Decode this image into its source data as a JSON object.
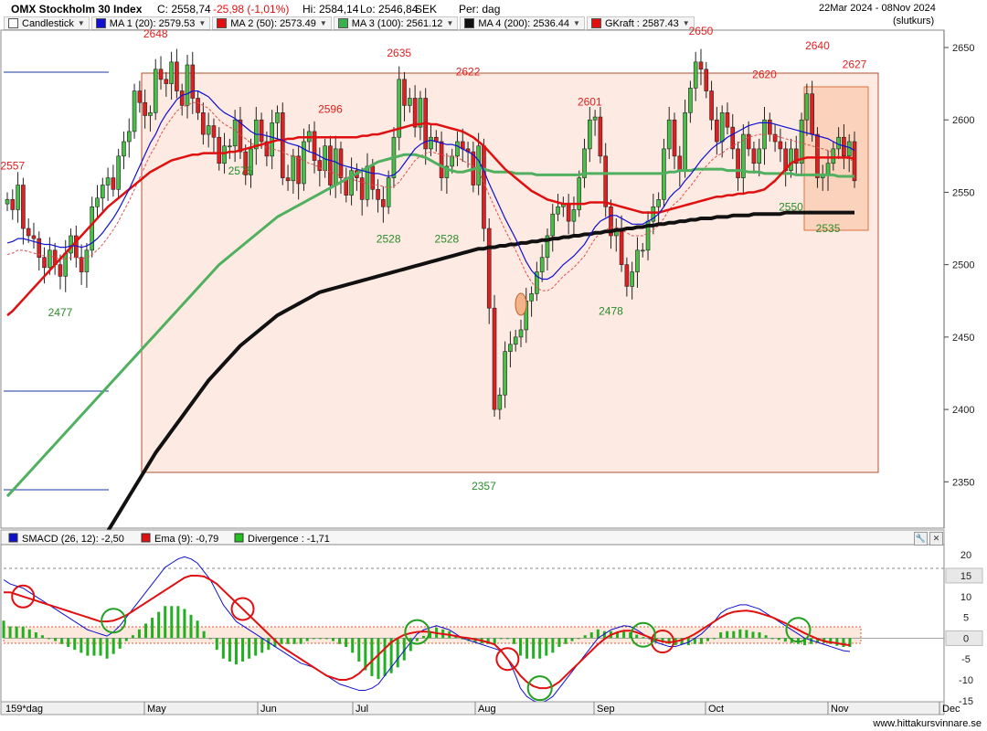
{
  "header": {
    "title": "OMX Stockholm 30 Index",
    "close": "C: 2558,74",
    "change": "-25,98 (-1,01%)",
    "high": "Hi: 2584,14",
    "low": "Lo: 2546,84",
    "currency": "SEK",
    "period": "Per: dag",
    "date_range": "22Mar 2024 - 08Nov 2024",
    "price_type": "(slutkurs)"
  },
  "legend": [
    {
      "label": "Candlestick",
      "color": "#ffffff"
    },
    {
      "label": "MA 1 (20): 2579.53",
      "color": "#1010d0"
    },
    {
      "label": "MA 2 (50): 2573.49",
      "color": "#e01010"
    },
    {
      "label": "MA 3 (100): 2561.12",
      "color": "#3cb04c"
    },
    {
      "label": "MA 4 (200): 2536.44",
      "color": "#111111"
    },
    {
      "label": "GKraft : 2587.43",
      "color": "#e01010"
    }
  ],
  "sub_legend": [
    {
      "label": "SMACD (26, 12): -2,50",
      "color": "#1010d0"
    },
    {
      "label": "Ema (9): -0,79",
      "color": "#e01010"
    },
    {
      "label": "Divergence : -1,71",
      "color": "#22c022"
    }
  ],
  "footer": {
    "period_label": "159*dag",
    "site": "www.hittakursvinnare.se"
  },
  "chart_data": [
    {
      "type": "line",
      "title": "OMX Stockholm 30 Index",
      "y_axis_ticks": [
        2350,
        2400,
        2450,
        2500,
        2550,
        2600,
        2650
      ],
      "ylim": [
        2318,
        2662
      ],
      "x_month_labels": [
        "May",
        "Jun",
        "Jul",
        "Aug",
        "Sep",
        "Oct",
        "Nov",
        "Dec"
      ],
      "annotations_high": [
        {
          "value": "2557",
          "i": 1
        },
        {
          "value": "2648",
          "i": 28
        },
        {
          "value": "2635",
          "i": 74
        },
        {
          "value": "2622",
          "i": 87
        },
        {
          "value": "2596",
          "i": 61
        },
        {
          "value": "2601",
          "i": 110
        },
        {
          "value": "2650",
          "i": 131
        },
        {
          "value": "2620",
          "i": 143
        },
        {
          "value": "2640",
          "i": 153
        },
        {
          "value": "2627",
          "i": 160
        }
      ],
      "annotations_low": [
        {
          "value": "2477",
          "i": 10
        },
        {
          "value": "2575",
          "i": 44
        },
        {
          "value": "2528",
          "i": 72
        },
        {
          "value": "2528",
          "i": 83
        },
        {
          "value": "2357",
          "i": 90
        },
        {
          "value": "2478",
          "i": 114
        },
        {
          "value": "2550",
          "i": 148
        },
        {
          "value": "2535",
          "i": 155
        }
      ],
      "close_series": [
        2545,
        2538,
        2555,
        2525,
        2520,
        2518,
        2505,
        2498,
        2510,
        2500,
        2492,
        2508,
        2520,
        2505,
        2495,
        2510,
        2540,
        2546,
        2555,
        2560,
        2552,
        2575,
        2585,
        2592,
        2620,
        2612,
        2603,
        2605,
        2635,
        2628,
        2625,
        2640,
        2620,
        2610,
        2638,
        2615,
        2605,
        2590,
        2596,
        2588,
        2570,
        2582,
        2582,
        2600,
        2578,
        2562,
        2580,
        2600,
        2585,
        2575,
        2598,
        2605,
        2560,
        2558,
        2575,
        2556,
        2585,
        2592,
        2572,
        2565,
        2582,
        2555,
        2580,
        2560,
        2548,
        2565,
        2560,
        2545,
        2568,
        2552,
        2545,
        2540,
        2560,
        2588,
        2628,
        2610,
        2615,
        2595,
        2615,
        2580,
        2588,
        2585,
        2560,
        2568,
        2575,
        2585,
        2580,
        2578,
        2555,
        2582,
        2525,
        2470,
        2400,
        2410,
        2440,
        2445,
        2450,
        2455,
        2475,
        2480,
        2495,
        2505,
        2520,
        2535,
        2540,
        2542,
        2530,
        2538,
        2560,
        2580,
        2600,
        2602,
        2575,
        2540,
        2520,
        2525,
        2500,
        2485,
        2495,
        2510,
        2510,
        2530,
        2540,
        2545,
        2580,
        2600,
        2575,
        2565,
        2605,
        2622,
        2640,
        2635,
        2620,
        2600,
        2585,
        2605,
        2595,
        2580,
        2560,
        2590,
        2580,
        2570,
        2580,
        2600,
        2590,
        2585,
        2580,
        2565,
        2580,
        2570,
        2600,
        2618,
        2590,
        2560,
        2562,
        2570,
        2580,
        2588,
        2575,
        2585,
        2558
      ],
      "ma20": [
        2515,
        2516,
        2518,
        2518,
        2517,
        2516,
        2515,
        2514,
        2514,
        2513,
        2512,
        2512,
        2513,
        2513,
        2512,
        2513,
        2515,
        2518,
        2522,
        2527,
        2532,
        2538,
        2545,
        2552,
        2560,
        2568,
        2576,
        2584,
        2590,
        2598,
        2604,
        2609,
        2614,
        2617,
        2618,
        2620,
        2620,
        2618,
        2616,
        2612,
        2608,
        2605,
        2603,
        2601,
        2598,
        2595,
        2592,
        2590,
        2590,
        2589,
        2588,
        2587,
        2586,
        2584,
        2583,
        2582,
        2580,
        2578,
        2577,
        2575,
        2573,
        2572,
        2571,
        2569,
        2568,
        2567,
        2566,
        2565,
        2564,
        2563,
        2563,
        2562,
        2561,
        2562,
        2565,
        2570,
        2575,
        2580,
        2583,
        2585,
        2586,
        2585,
        2584,
        2583,
        2583,
        2582,
        2580,
        2578,
        2576,
        2572,
        2565,
        2556,
        2548,
        2540,
        2532,
        2525,
        2518,
        2510,
        2502,
        2496,
        2492,
        2490,
        2490,
        2492,
        2496,
        2500,
        2503,
        2506,
        2510,
        2514,
        2520,
        2526,
        2530,
        2532,
        2534,
        2534,
        2532,
        2530,
        2528,
        2528,
        2528,
        2530,
        2532,
        2535,
        2540,
        2546,
        2550,
        2553,
        2558,
        2562,
        2567,
        2572,
        2576,
        2580,
        2583,
        2585,
        2588,
        2590,
        2592,
        2594,
        2596,
        2597,
        2598,
        2598,
        2598,
        2597,
        2596,
        2595,
        2594,
        2593,
        2592,
        2591,
        2590,
        2589,
        2588,
        2587,
        2585,
        2583,
        2582,
        2581,
        2579
      ],
      "ma50": [
        2465,
        2468,
        2472,
        2476,
        2480,
        2484,
        2488,
        2492,
        2496,
        2500,
        2504,
        2508,
        2512,
        2516,
        2520,
        2524,
        2528,
        2532,
        2536,
        2540,
        2543,
        2546,
        2549,
        2552,
        2555,
        2558,
        2561,
        2564,
        2566,
        2568,
        2570,
        2572,
        2573,
        2574,
        2575,
        2576,
        2576,
        2577,
        2577,
        2577,
        2577,
        2577,
        2578,
        2578,
        2579,
        2580,
        2581,
        2582,
        2583,
        2584,
        2585,
        2586,
        2586,
        2587,
        2587,
        2588,
        2588,
        2588,
        2588,
        2588,
        2588,
        2588,
        2588,
        2588,
        2588,
        2588,
        2588,
        2589,
        2589,
        2590,
        2590,
        2591,
        2592,
        2593,
        2594,
        2595,
        2596,
        2597,
        2597,
        2598,
        2597,
        2597,
        2596,
        2595,
        2594,
        2593,
        2592,
        2590,
        2588,
        2585,
        2582,
        2578,
        2574,
        2570,
        2566,
        2563,
        2560,
        2557,
        2554,
        2551,
        2549,
        2547,
        2545,
        2544,
        2543,
        2542,
        2542,
        2542,
        2542,
        2542,
        2543,
        2543,
        2543,
        2543,
        2542,
        2541,
        2540,
        2539,
        2538,
        2537,
        2536,
        2536,
        2536,
        2536,
        2537,
        2538,
        2539,
        2540,
        2541,
        2542,
        2543,
        2544,
        2545,
        2546,
        2547,
        2547,
        2548,
        2548,
        2549,
        2549,
        2550,
        2550,
        2551,
        2552,
        2555,
        2558,
        2562,
        2566,
        2570,
        2572,
        2573,
        2574,
        2574,
        2574,
        2574,
        2574,
        2574,
        2574,
        2574,
        2574,
        2573
      ],
      "ma100": [
        2340,
        2344,
        2348,
        2352,
        2356,
        2360,
        2364,
        2368,
        2372,
        2376,
        2380,
        2384,
        2388,
        2392,
        2396,
        2400,
        2404,
        2408,
        2412,
        2416,
        2420,
        2424,
        2428,
        2432,
        2436,
        2440,
        2444,
        2448,
        2452,
        2456,
        2460,
        2464,
        2468,
        2472,
        2476,
        2480,
        2484,
        2488,
        2492,
        2496,
        2500,
        2503,
        2506,
        2509,
        2512,
        2515,
        2518,
        2521,
        2524,
        2527,
        2530,
        2533,
        2535,
        2537,
        2539,
        2541,
        2543,
        2545,
        2547,
        2549,
        2551,
        2553,
        2555,
        2557,
        2559,
        2561,
        2563,
        2565,
        2567,
        2569,
        2571,
        2572,
        2573,
        2574,
        2575,
        2576,
        2576,
        2576,
        2575,
        2574,
        2572,
        2570,
        2568,
        2566,
        2565,
        2564,
        2564,
        2565,
        2566,
        2567,
        2566,
        2565,
        2564,
        2564,
        2564,
        2564,
        2563,
        2563,
        2563,
        2563,
        2562,
        2562,
        2562,
        2562,
        2562,
        2562,
        2562,
        2562,
        2562,
        2563,
        2563,
        2563,
        2563,
        2563,
        2563,
        2563,
        2563,
        2563,
        2563,
        2563,
        2563,
        2563,
        2563,
        2563,
        2563,
        2564,
        2564,
        2565,
        2565,
        2565,
        2566,
        2566,
        2566,
        2566,
        2566,
        2566,
        2565,
        2565,
        2565,
        2565,
        2564,
        2564,
        2564,
        2563,
        2563,
        2563,
        2563,
        2563,
        2563,
        2562,
        2562,
        2562,
        2562,
        2562,
        2562,
        2562,
        2562,
        2561,
        2561,
        2561,
        2561
      ],
      "ma200": [
        2212,
        2216,
        2220,
        2225,
        2230,
        2235,
        2240,
        2245,
        2250,
        2256,
        2262,
        2268,
        2274,
        2280,
        2286,
        2292,
        2298,
        2304,
        2310,
        2316,
        2322,
        2328,
        2334,
        2340,
        2346,
        2352,
        2358,
        2364,
        2370,
        2375,
        2380,
        2385,
        2390,
        2395,
        2400,
        2405,
        2410,
        2415,
        2420,
        2424,
        2428,
        2432,
        2436,
        2440,
        2444,
        2447,
        2450,
        2453,
        2456,
        2459,
        2462,
        2465,
        2467,
        2469,
        2471,
        2473,
        2475,
        2477,
        2479,
        2481,
        2482,
        2483,
        2484,
        2485,
        2486,
        2487,
        2488,
        2489,
        2490,
        2491,
        2492,
        2493,
        2494,
        2495,
        2496,
        2497,
        2498,
        2499,
        2500,
        2501,
        2502,
        2503,
        2504,
        2505,
        2506,
        2507,
        2508,
        2509,
        2510,
        2511,
        2511,
        2512,
        2512,
        2513,
        2513,
        2514,
        2514,
        2515,
        2515,
        2516,
        2516,
        2517,
        2517,
        2518,
        2518,
        2519,
        2519,
        2520,
        2520,
        2521,
        2521,
        2522,
        2522,
        2523,
        2523,
        2524,
        2524,
        2525,
        2525,
        2526,
        2526,
        2527,
        2527,
        2528,
        2528,
        2529,
        2529,
        2530,
        2530,
        2531,
        2531,
        2532,
        2532,
        2532,
        2533,
        2533,
        2533,
        2534,
        2534,
        2534,
        2534,
        2535,
        2535,
        2535,
        2535,
        2535,
        2535,
        2536,
        2536,
        2536,
        2536,
        2536,
        2536,
        2536,
        2536,
        2536,
        2536,
        2536,
        2536,
        2536,
        2536
      ]
    },
    {
      "type": "line",
      "title": "SMACD",
      "y_axis_ticks": [
        -15,
        -10,
        -5.0,
        0,
        5.0,
        10,
        15,
        20
      ],
      "ylim": [
        -17,
        22
      ],
      "smacd": [
        14,
        13,
        12.5,
        12,
        11,
        10,
        9,
        8,
        7,
        6,
        5,
        4,
        3,
        2,
        1.5,
        1,
        0.5,
        1.5,
        3,
        5,
        7,
        9,
        11,
        13,
        15,
        17,
        18,
        19,
        19.5,
        19,
        18,
        16,
        14,
        11,
        8,
        6,
        4,
        3,
        2,
        1,
        0,
        -1,
        -2,
        -3,
        -4,
        -5,
        -6,
        -6.5,
        -7,
        -8,
        -9,
        -10,
        -11,
        -11.5,
        -12,
        -12.5,
        -12.5,
        -12,
        -11,
        -9,
        -7,
        -5,
        -3,
        -1,
        1,
        2,
        2.5,
        3,
        2.5,
        2,
        1,
        0,
        -0.5,
        -1,
        -1.5,
        -2,
        -2.5,
        -3,
        -5,
        -8,
        -12,
        -14,
        -15,
        -15.5,
        -15,
        -14,
        -12,
        -10,
        -8,
        -6,
        -4,
        -2,
        0,
        1,
        2,
        2.5,
        3,
        2.8,
        2,
        1,
        0,
        -1,
        -1.5,
        -2,
        -2,
        -1.5,
        -1,
        0,
        1,
        2.5,
        4,
        6,
        7,
        7.5,
        8,
        8,
        7.5,
        7,
        6,
        5,
        4,
        3,
        2,
        1,
        0,
        -0.5,
        -1,
        -1.5,
        -2,
        -2.5,
        -3,
        -3.2
      ],
      "ema": [
        11,
        11,
        10.5,
        10,
        9.5,
        9,
        8.5,
        8,
        7.5,
        7,
        6.5,
        6,
        5.5,
        5,
        4.5,
        4,
        4,
        4.2,
        4.8,
        5.5,
        6.5,
        7.5,
        8.5,
        9.5,
        10.5,
        11.5,
        12.5,
        13.5,
        14.5,
        15,
        15,
        14.8,
        14,
        13,
        11.5,
        10,
        8.5,
        7,
        5.5,
        4,
        2.5,
        1,
        -0.5,
        -2,
        -3,
        -4,
        -5,
        -6,
        -7,
        -8,
        -9,
        -9.5,
        -10,
        -10,
        -9.5,
        -8.5,
        -7,
        -5.5,
        -4,
        -2.5,
        -1,
        0,
        0.8,
        1.2,
        1.5,
        1.6,
        1.5,
        1.2,
        1,
        0.8,
        0.5,
        0.2,
        0,
        -0.3,
        -0.6,
        -1,
        -1.5,
        -3,
        -5,
        -7,
        -9,
        -10.5,
        -11.5,
        -12,
        -12,
        -11.5,
        -10.5,
        -9,
        -7.5,
        -6,
        -4.5,
        -3,
        -1.5,
        -0.2,
        0.8,
        1.4,
        1.8,
        1.8,
        1.4,
        0.8,
        0.2,
        -0.4,
        -0.8,
        -1,
        -0.8,
        -0.4,
        0.2,
        1,
        2,
        3,
        4,
        5,
        5.8,
        6.3,
        6.5,
        6.6,
        6.4,
        6,
        5.5,
        5,
        4.3,
        3.6,
        2.8,
        2,
        1.2,
        0.5,
        -0.2,
        -0.7,
        -1,
        -1.2,
        -1.5,
        -1.7
      ],
      "circles_red": [
        3,
        37,
        78,
        102
      ],
      "circles_green": [
        17,
        64,
        83,
        99,
        123
      ]
    }
  ]
}
